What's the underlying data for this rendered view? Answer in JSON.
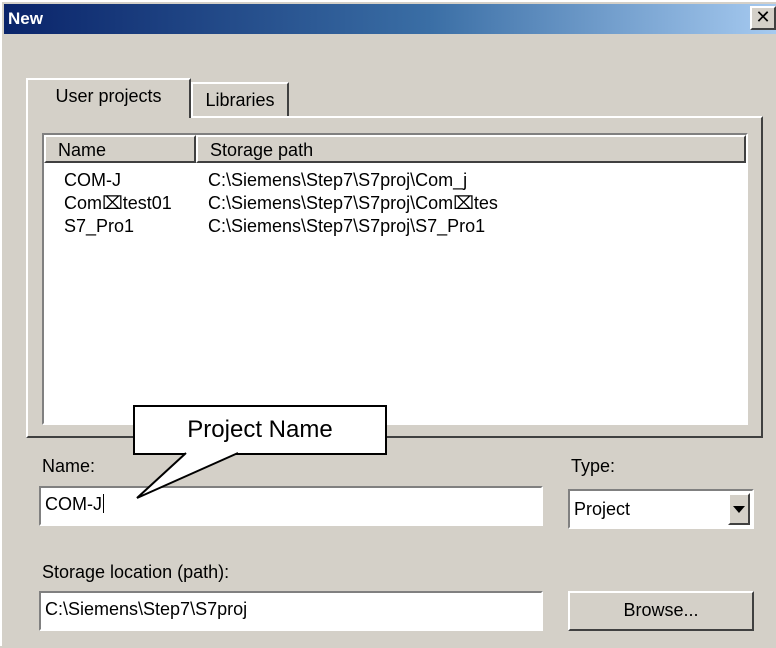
{
  "window": {
    "title": "New",
    "close_glyph": "✕"
  },
  "tabs": [
    {
      "label": "User projects",
      "active": true
    },
    {
      "label": "Libraries",
      "active": false
    }
  ],
  "project_list": {
    "columns": [
      "Name",
      "Storage path"
    ],
    "rows": [
      {
        "name": "COM-J",
        "path": "C:\\Siemens\\Step7\\S7proj\\Com_j"
      },
      {
        "name": "Com⌧test01",
        "path": "C:\\Siemens\\Step7\\S7proj\\Com⌧tes"
      },
      {
        "name": "S7_Pro1",
        "path": "C:\\Siemens\\Step7\\S7proj\\S7_Pro1"
      }
    ]
  },
  "callout": {
    "text": "Project Name"
  },
  "form": {
    "name_label": "Name:",
    "name_value": "COM-J",
    "type_label": "Type:",
    "type_value": "Project",
    "storage_label": "Storage location (path):",
    "storage_value": "C:\\Siemens\\Step7\\S7proj",
    "browse_label": "Browse..."
  },
  "icons": {
    "close": "close-icon",
    "dropdown": "chevron-down-icon"
  },
  "colors": {
    "title_start": "#0a246a",
    "title_end": "#a6caf0",
    "face": "#d4d0c8"
  }
}
